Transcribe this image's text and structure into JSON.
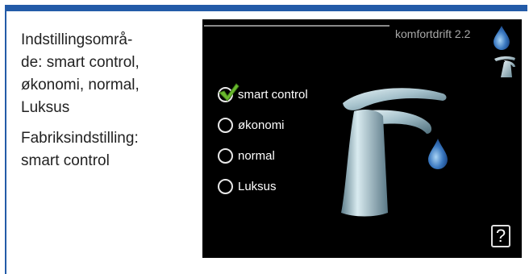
{
  "side_panel": {
    "range_text": [
      "Indstillingsområ-",
      "de: smart control,",
      "økonomi, normal,",
      "Luksus"
    ],
    "factory_text": [
      "Fabriksindstilling:",
      "smart control"
    ]
  },
  "screen": {
    "title": "komfortdrift 2.2",
    "options": [
      {
        "label": "smart control",
        "checked": true
      },
      {
        "label": "økonomi",
        "checked": false
      },
      {
        "label": "normal",
        "checked": false
      },
      {
        "label": "Luksus",
        "checked": false
      }
    ],
    "help_label": "?"
  },
  "colors": {
    "frame_blue": "#235ba8",
    "screen_bg": "#000000",
    "check_green": "#6ab82e",
    "water_blue": "#3a78c0"
  }
}
